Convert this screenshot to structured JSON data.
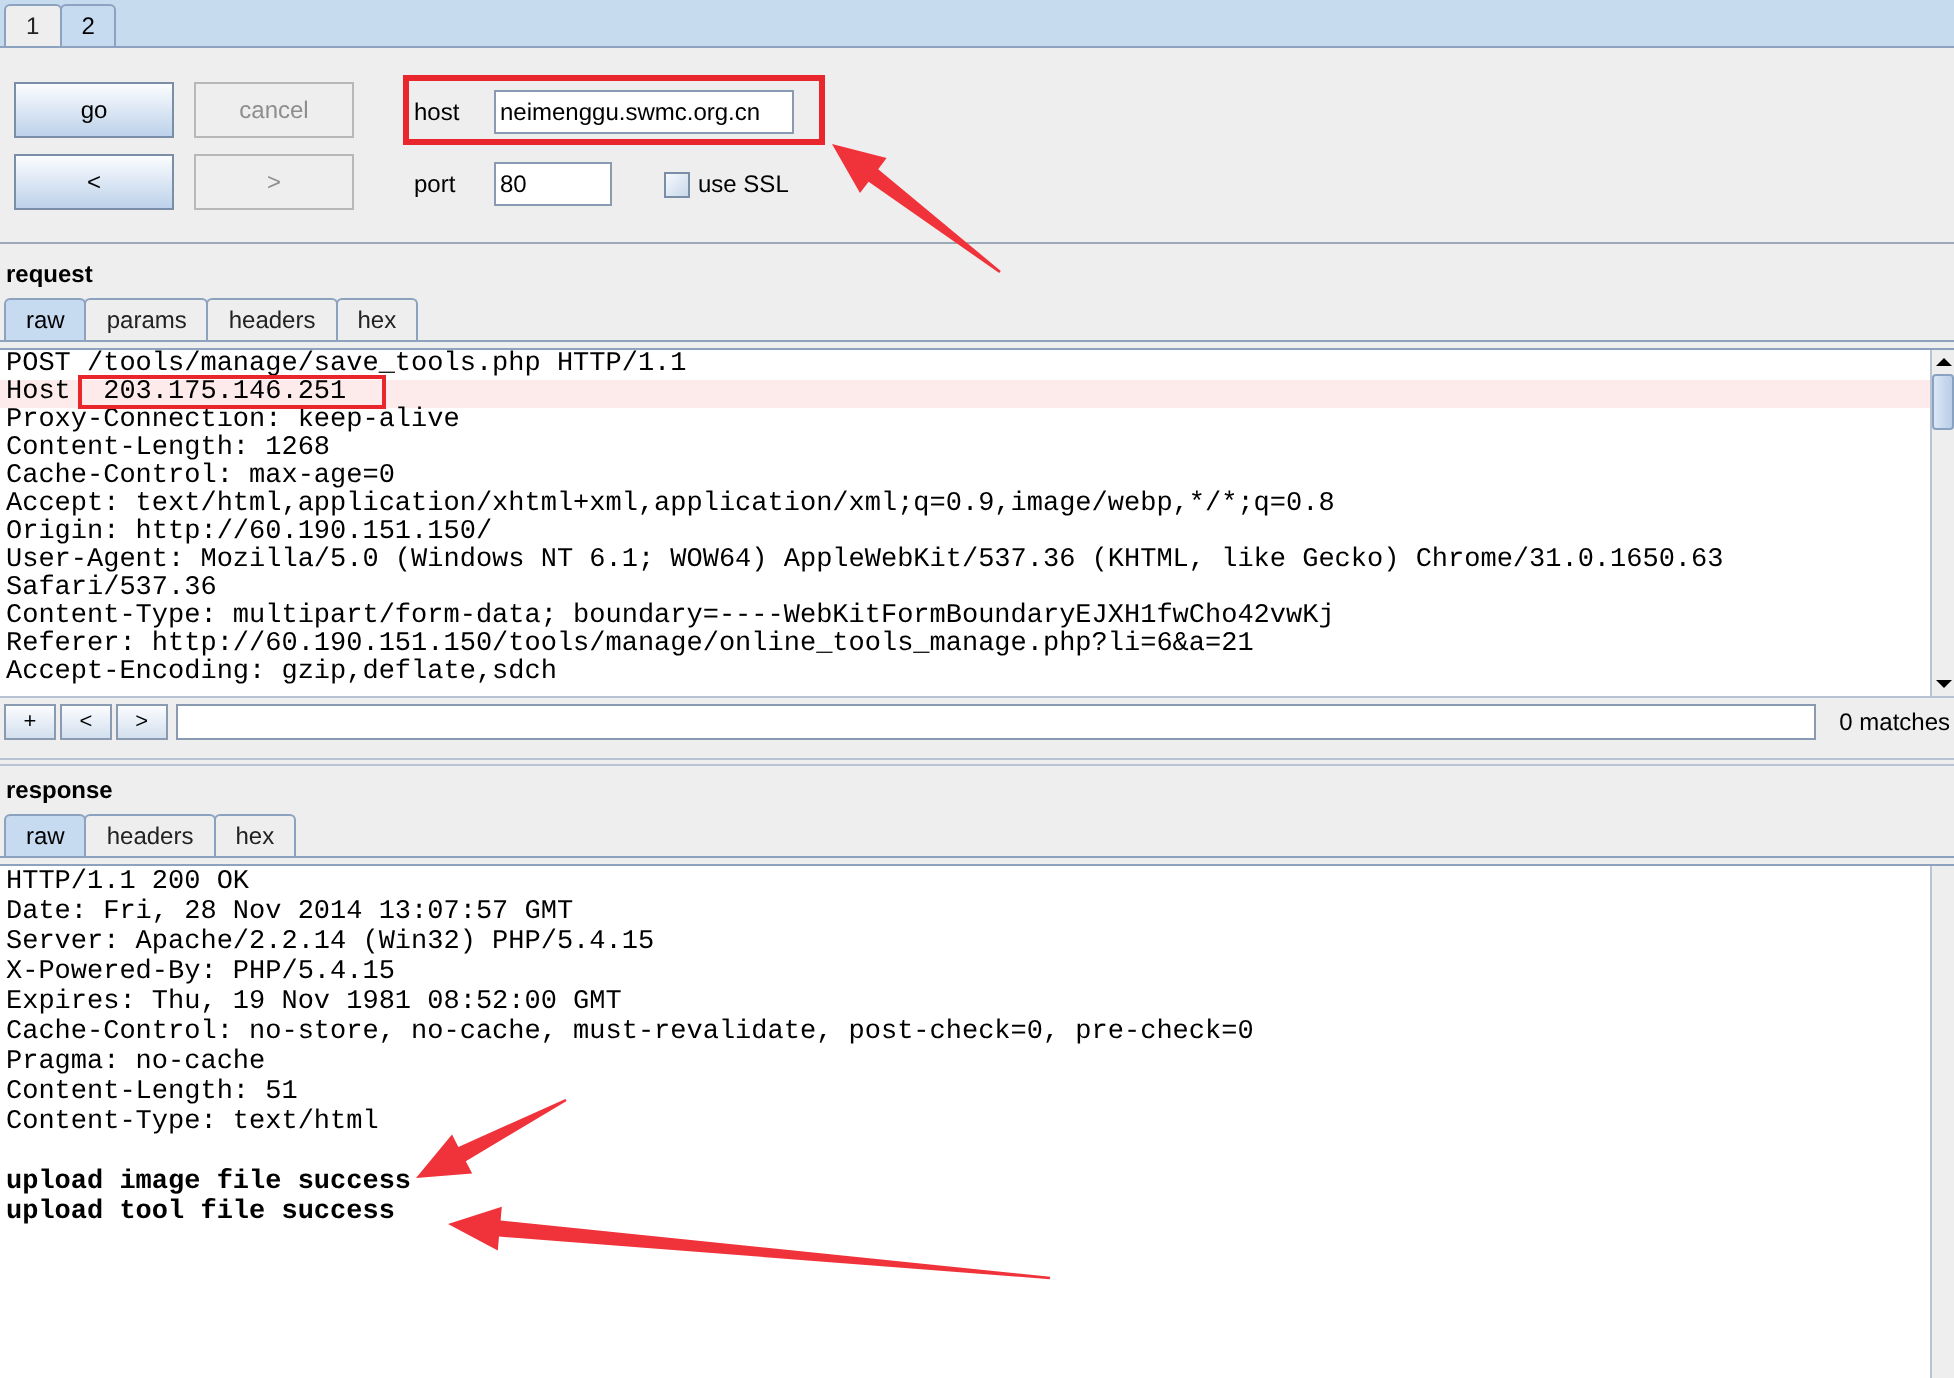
{
  "window_tabs": [
    {
      "label": "1",
      "selected": false
    },
    {
      "label": "2",
      "selected": true
    }
  ],
  "toolbar": {
    "buttons": [
      {
        "label": "go",
        "disabled": false
      },
      {
        "label": "cancel",
        "disabled": true
      },
      {
        "label": "<",
        "disabled": false
      },
      {
        "label": ">",
        "disabled": true
      }
    ],
    "host": {
      "label": "host",
      "value": "neimenggu.swmc.org.cn"
    },
    "port": {
      "label": "port",
      "value": "80"
    },
    "use_ssl": {
      "label": "use SSL",
      "checked": false
    }
  },
  "request": {
    "title": "request",
    "tabs": [
      {
        "label": "raw",
        "selected": true
      },
      {
        "label": "params",
        "selected": false
      },
      {
        "label": "headers",
        "selected": false
      },
      {
        "label": "hex",
        "selected": false
      }
    ],
    "lines": [
      {
        "text": "POST /tools/manage/save_tools.php HTTP/1.1",
        "highlighted": false
      },
      {
        "text": "Host  203.175.146.251",
        "highlighted": true
      },
      {
        "text": "Proxy-Connection: keep-alive",
        "highlighted": false
      },
      {
        "text": "Content-Length: 1268",
        "highlighted": false
      },
      {
        "text": "Cache-Control: max-age=0",
        "highlighted": false
      },
      {
        "text": "Accept: text/html,application/xhtml+xml,application/xml;q=0.9,image/webp,*/*;q=0.8",
        "highlighted": false
      },
      {
        "text": "Origin: http://60.190.151.150/",
        "highlighted": false
      },
      {
        "text": "User-Agent: Mozilla/5.0 (Windows NT 6.1; WOW64) AppleWebKit/537.36 (KHTML, like Gecko) Chrome/31.0.1650.63",
        "highlighted": false
      },
      {
        "text": "Safari/537.36",
        "highlighted": false
      },
      {
        "text": "Content-Type: multipart/form-data; boundary=----WebKitFormBoundaryEJXH1fwCho42vwKj",
        "highlighted": false
      },
      {
        "text": "Referer: http://60.190.151.150/tools/manage/online_tools_manage.php?li=6&a=21",
        "highlighted": false
      },
      {
        "text": "Accept-Encoding: gzip,deflate,sdch",
        "highlighted": false
      }
    ],
    "search": {
      "buttons": [
        "+",
        "<",
        ">"
      ],
      "matches": "0 matches"
    }
  },
  "response": {
    "title": "response",
    "tabs": [
      {
        "label": "raw",
        "selected": true
      },
      {
        "label": "headers",
        "selected": false
      },
      {
        "label": "hex",
        "selected": false
      }
    ],
    "lines": [
      {
        "kind": "plain",
        "text": "HTTP/1.1 200 OK"
      },
      {
        "kind": "plain",
        "text": "Date: Fri, 28 Nov 2014 13:07:57 GMT"
      },
      {
        "kind": "plain",
        "text": "Server: Apache/2.2.14 (Win32) PHP/5.4.15"
      },
      {
        "kind": "plain",
        "text": "X-Powered-By: PHP/5.4.15"
      },
      {
        "kind": "plain",
        "text": "Expires: Thu, 19 Nov 1981 08:52:00 GMT"
      },
      {
        "kind": "plain",
        "text": "Cache-Control: no-store, no-cache, must-revalidate, post-check=0, pre-check=0"
      },
      {
        "kind": "plain",
        "text": "Pragma: no-cache"
      },
      {
        "kind": "plain",
        "text": "Content-Length: 51"
      },
      {
        "kind": "plain",
        "text": "Content-Type: text/html"
      },
      {
        "kind": "blank"
      },
      {
        "kind": "bold",
        "text": "upload image file success"
      },
      {
        "kind": "bold",
        "text": "upload tool file success"
      }
    ]
  }
}
